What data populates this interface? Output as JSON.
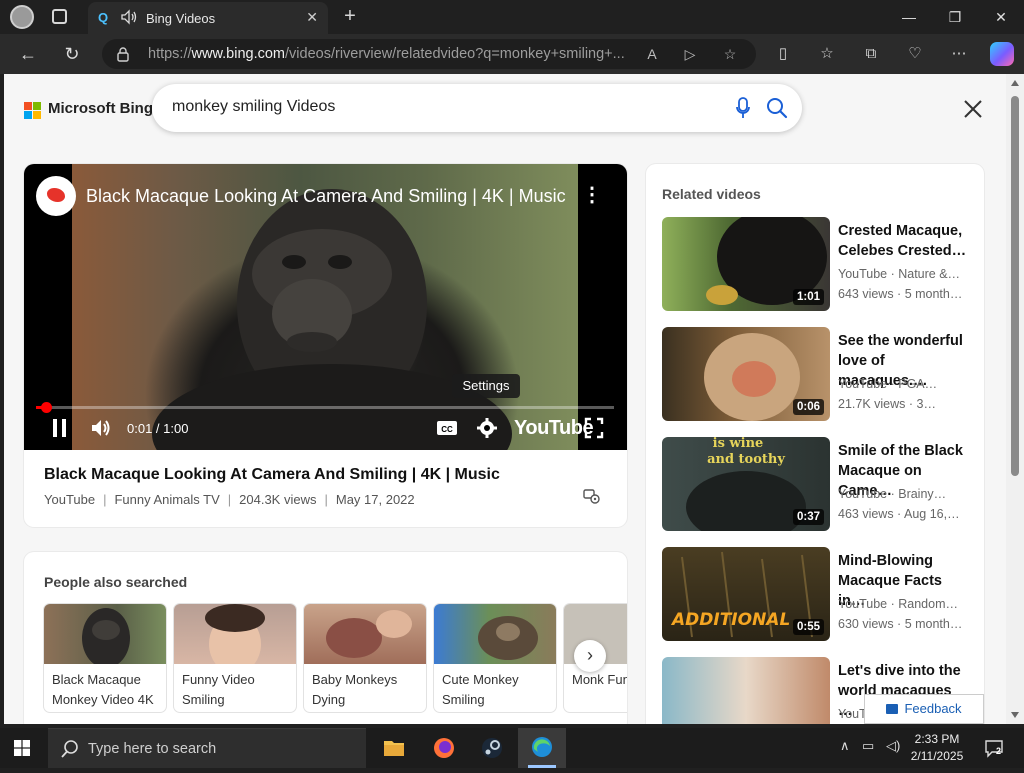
{
  "browser": {
    "tab_title": "Bing Videos",
    "tab_favicon_text": "Q",
    "url_prefix": "https://",
    "url_domain": "www.bing.com",
    "url_rest": "/videos/riverview/relatedvideo?q=monkey+smiling+..."
  },
  "bing": {
    "logo_text": "Microsoft Bing",
    "query": "monkey smiling Videos"
  },
  "player": {
    "overlay_title": "Black Macaque Looking At Camera And Smiling | 4K | Music",
    "time": "0:01 / 1:00",
    "progress": 0.017,
    "tooltip": "Settings",
    "youtube_label": "YouTube",
    "title": "Black Macaque Looking At Camera And Smiling | 4K | Music",
    "source": "YouTube",
    "channel": "Funny Animals TV",
    "views": "204.3K views",
    "date": "May 17, 2022"
  },
  "people_also_searched": {
    "heading": "People also searched",
    "items": [
      {
        "label": "Black Macaque Monkey Video 4K"
      },
      {
        "label": "Funny Video Smiling"
      },
      {
        "label": "Baby Monkeys Dying"
      },
      {
        "label": "Cute Monkey Smiling"
      },
      {
        "label": "Monk Funny"
      }
    ]
  },
  "related": {
    "heading": "Related videos",
    "items": [
      {
        "title": "Crested Macaque, Celebes Crested…",
        "source_line": "YouTube · Nature &…",
        "stats_line": "643 views · 5 month…",
        "duration": "1:01"
      },
      {
        "title": "See the wonderful love of macaques.…",
        "source_line": "YouTube · PGA…",
        "stats_line": "21.7K views · 3…",
        "duration": "0:06"
      },
      {
        "title": "Smile of the Black Macaque on Came…",
        "source_line": "YouTube · Brainy…",
        "stats_line": "463 views · Aug 16,…",
        "duration": "0:37"
      },
      {
        "title": "Mind-Blowing Macaque Facts in…",
        "source_line": "YouTube · Random…",
        "stats_line": "630 views · 5 month…",
        "duration": "0:55"
      },
      {
        "title": "Let's dive into the world macaques …",
        "source_line": "YouTube",
        "stats_line": "",
        "duration": ""
      }
    ],
    "thumb3_caption_line1": "is wine",
    "thumb3_caption_line2": "and toothy",
    "thumb4_caption": "ADDITIONAL"
  },
  "feedback_label": "Feedback",
  "taskbar": {
    "search_placeholder": "Type here to search",
    "time": "2:33 PM",
    "date": "2/11/2025",
    "notification_count": "2"
  },
  "colors": {
    "bing_accent": "#1a73e8",
    "progress_red": "#ff0000",
    "page_bg": "#f6f6f6"
  }
}
